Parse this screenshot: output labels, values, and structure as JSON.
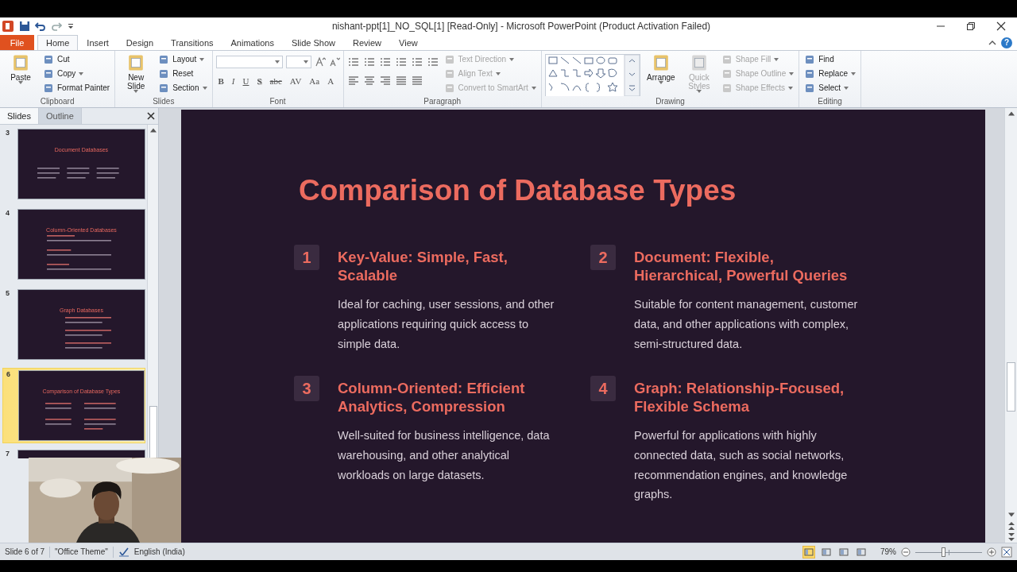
{
  "window": {
    "title": "nishant-ppt[1]_NO_SQL[1] [Read-Only] - Microsoft PowerPoint (Product Activation Failed)",
    "help": "?"
  },
  "ribbon_tabs": [
    {
      "label": "File",
      "kind": "file",
      "selected": false
    },
    {
      "label": "Home",
      "kind": "tab",
      "selected": true
    },
    {
      "label": "Insert",
      "kind": "tab",
      "selected": false
    },
    {
      "label": "Design",
      "kind": "tab",
      "selected": false
    },
    {
      "label": "Transitions",
      "kind": "tab",
      "selected": false
    },
    {
      "label": "Animations",
      "kind": "tab",
      "selected": false
    },
    {
      "label": "Slide Show",
      "kind": "tab",
      "selected": false
    },
    {
      "label": "Review",
      "kind": "tab",
      "selected": false
    },
    {
      "label": "View",
      "kind": "tab",
      "selected": false
    }
  ],
  "ribbon_groups": [
    {
      "label": "Clipboard",
      "items": [
        {
          "kind": "large",
          "label": "Paste",
          "dropdown": true,
          "disabled": false
        },
        {
          "kind": "small",
          "label": "Cut",
          "dropdown": false,
          "disabled": false
        },
        {
          "kind": "small",
          "label": "Copy",
          "dropdown": true,
          "disabled": false
        },
        {
          "kind": "small",
          "label": "Format Painter",
          "dropdown": false,
          "disabled": false
        }
      ]
    },
    {
      "label": "Slides",
      "items": [
        {
          "kind": "large",
          "label": "New Slide",
          "dropdown": true,
          "disabled": false
        },
        {
          "kind": "small",
          "label": "Layout",
          "dropdown": true,
          "disabled": false
        },
        {
          "kind": "small",
          "label": "Reset",
          "dropdown": false,
          "disabled": false
        },
        {
          "kind": "small",
          "label": "Section",
          "dropdown": true,
          "disabled": false
        }
      ]
    },
    {
      "label": "Font",
      "items": [
        {
          "kind": "font-controls",
          "buttons": [
            "B",
            "I",
            "U",
            "S",
            "abc",
            "AV",
            "Aa",
            "A"
          ]
        }
      ]
    },
    {
      "label": "Paragraph",
      "items": [
        {
          "kind": "paragraph-controls"
        },
        {
          "kind": "small",
          "label": "Text Direction",
          "dropdown": true,
          "disabled": true
        },
        {
          "kind": "small",
          "label": "Align Text",
          "dropdown": true,
          "disabled": true
        },
        {
          "kind": "small",
          "label": "Convert to SmartArt",
          "dropdown": true,
          "disabled": true
        }
      ]
    },
    {
      "label": "Drawing",
      "items": [
        {
          "kind": "shapes-gallery"
        },
        {
          "kind": "large",
          "label": "Arrange",
          "dropdown": true,
          "disabled": false
        },
        {
          "kind": "large",
          "label": "Quick Styles",
          "dropdown": true,
          "disabled": true
        },
        {
          "kind": "small",
          "label": "Shape Fill",
          "dropdown": true,
          "disabled": true
        },
        {
          "kind": "small",
          "label": "Shape Outline",
          "dropdown": true,
          "disabled": true
        },
        {
          "kind": "small",
          "label": "Shape Effects",
          "dropdown": true,
          "disabled": true
        }
      ]
    },
    {
      "label": "Editing",
      "items": [
        {
          "kind": "small",
          "label": "Find",
          "dropdown": false,
          "disabled": false
        },
        {
          "kind": "small",
          "label": "Replace",
          "dropdown": true,
          "disabled": false
        },
        {
          "kind": "small",
          "label": "Select",
          "dropdown": true,
          "disabled": false
        }
      ]
    }
  ],
  "pane_tabs": [
    {
      "label": "Slides",
      "selected": true
    },
    {
      "label": "Outline",
      "selected": false
    }
  ],
  "thumbnails": [
    {
      "number": "3",
      "title": "Document Databases",
      "kind": "columns",
      "selected": false
    },
    {
      "number": "4",
      "title": "Column-Oriented Databases",
      "kind": "list",
      "selected": false
    },
    {
      "number": "5",
      "title": "Graph Databases",
      "kind": "timeline",
      "selected": false
    },
    {
      "number": "6",
      "title": "Comparison of Database Types",
      "kind": "grid",
      "selected": true
    },
    {
      "number": "7",
      "selected": false
    }
  ],
  "slide": {
    "title": "Comparison of Database Types",
    "items": [
      {
        "number": "1",
        "heading": "Key-Value: Simple, Fast, Scalable",
        "body": "Ideal for caching, user sessions, and other applications requiring quick access to simple data."
      },
      {
        "number": "2",
        "heading": "Document: Flexible, Hierarchical, Powerful Queries",
        "body": "Suitable for content management, customer data, and other applications with complex, semi-structured data."
      },
      {
        "number": "3",
        "heading": "Column-Oriented: Efficient Analytics, Compression",
        "body": "Well-suited for business intelligence, data warehousing, and other analytical workloads on large datasets."
      },
      {
        "number": "4",
        "heading": "Graph: Relationship-Focused, Flexible Schema",
        "body": "Powerful for applications with highly connected data, such as social networks, recommendation engines, and knowledge graphs."
      }
    ]
  },
  "status_bar": {
    "slide": "Slide 6 of 7",
    "theme": "\"Office Theme\"",
    "language": "English (India)",
    "views": [
      {
        "selected": true
      },
      {
        "selected": false
      },
      {
        "selected": false
      },
      {
        "selected": false
      }
    ],
    "zoom": "79%",
    "zoom_slider": {
      "level": 0.42
    }
  }
}
